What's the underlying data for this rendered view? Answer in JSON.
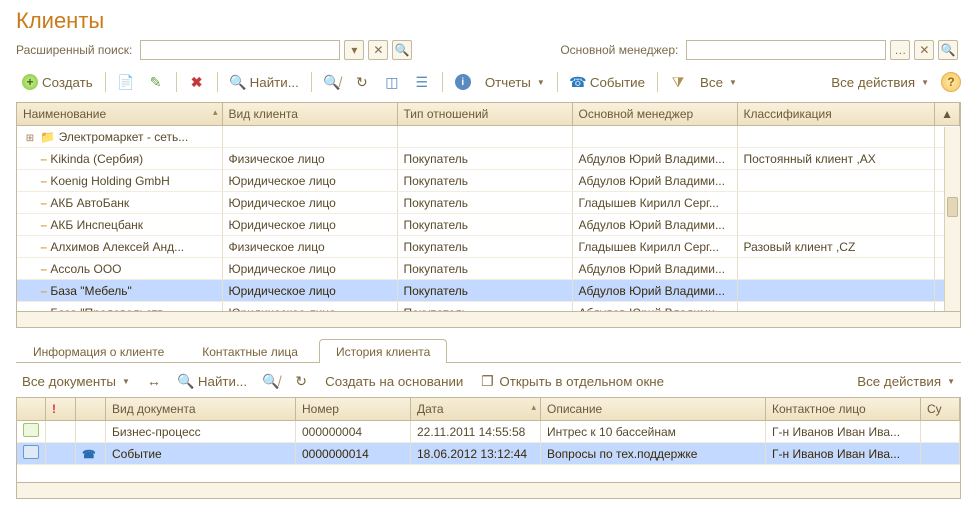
{
  "page": {
    "title": "Клиенты"
  },
  "search": {
    "extended_label": "Расширенный поиск:",
    "extended_value": "",
    "manager_label": "Основной менеджер:",
    "manager_value": ""
  },
  "toolbar": {
    "create": "Создать",
    "find": "Найти...",
    "reports": "Отчеты",
    "event": "Событие",
    "all": "Все",
    "all_actions": "Все действия"
  },
  "grid": {
    "columns": {
      "name": "Наименование",
      "type": "Вид клиента",
      "relation": "Тип отношений",
      "manager": "Основной менеджер",
      "classification": "Классификация"
    },
    "rows": [
      {
        "name": "Электромаркет - сеть...",
        "type": "",
        "relation": "",
        "manager": "",
        "classification": "",
        "folder": true,
        "expandable": true
      },
      {
        "name": "Kikinda (Сербия)",
        "type": "Физическое лицо",
        "relation": "Покупатель",
        "manager": "Абдулов Юрий Владими...",
        "classification": "Постоянный клиент ,AX"
      },
      {
        "name": "Koenig Holding GmbH",
        "type": "Юридическое лицо",
        "relation": "Покупатель",
        "manager": "Абдулов Юрий Владими...",
        "classification": ""
      },
      {
        "name": "АКБ АвтоБанк",
        "type": "Юридическое лицо",
        "relation": "Покупатель",
        "manager": "Гладышев Кирилл Серг...",
        "classification": ""
      },
      {
        "name": "АКБ Инспецбанк",
        "type": "Юридическое лицо",
        "relation": "Покупатель",
        "manager": "Абдулов Юрий Владими...",
        "classification": ""
      },
      {
        "name": "Алхимов Алексей Анд...",
        "type": "Физическое лицо",
        "relation": "Покупатель",
        "manager": "Гладышев Кирилл Серг...",
        "classification": "Разовый клиент ,CZ"
      },
      {
        "name": "Ассоль ООО",
        "type": "Юридическое лицо",
        "relation": "Покупатель",
        "manager": "Абдулов Юрий Владими...",
        "classification": ""
      },
      {
        "name": "База \"Мебель\"",
        "type": "Юридическое лицо",
        "relation": "Покупатель",
        "manager": "Абдулов Юрий Владими...",
        "classification": "",
        "selected": true
      },
      {
        "name": "База \"Продовольств...",
        "type": "Юридическое лицо",
        "relation": "Покупатель",
        "manager": "Абдулов Юрий Владими...",
        "classification": "",
        "cut": true
      }
    ]
  },
  "tabs": {
    "info": "Информация о клиенте",
    "contacts": "Контактные лица",
    "history": "История клиента"
  },
  "subtoolbar": {
    "all_docs": "Все документы",
    "find": "Найти...",
    "create_on": "Создать на основании",
    "open_window": "Открыть в отдельном окне",
    "all_actions": "Все действия"
  },
  "histgrid": {
    "columns": {
      "doctype": "Вид документа",
      "number": "Номер",
      "date": "Дата",
      "desc": "Описание",
      "contact": "Контактное лицо",
      "last": "Су"
    },
    "rows": [
      {
        "doctype": "Бизнес-процесс",
        "number": "000000004",
        "date": "22.11.2011 14:55:58",
        "desc": "Интрес к 10 бассейнам",
        "contact": "Г-н Иванов Иван Ива...",
        "icon": "doc"
      },
      {
        "doctype": "Событие",
        "number": "0000000014",
        "date": "18.06.2012 13:12:44",
        "desc": "Вопросы по тех.поддержке",
        "contact": "Г-н Иванов Иван Ива...",
        "selected": true,
        "icon": "evt"
      }
    ]
  }
}
